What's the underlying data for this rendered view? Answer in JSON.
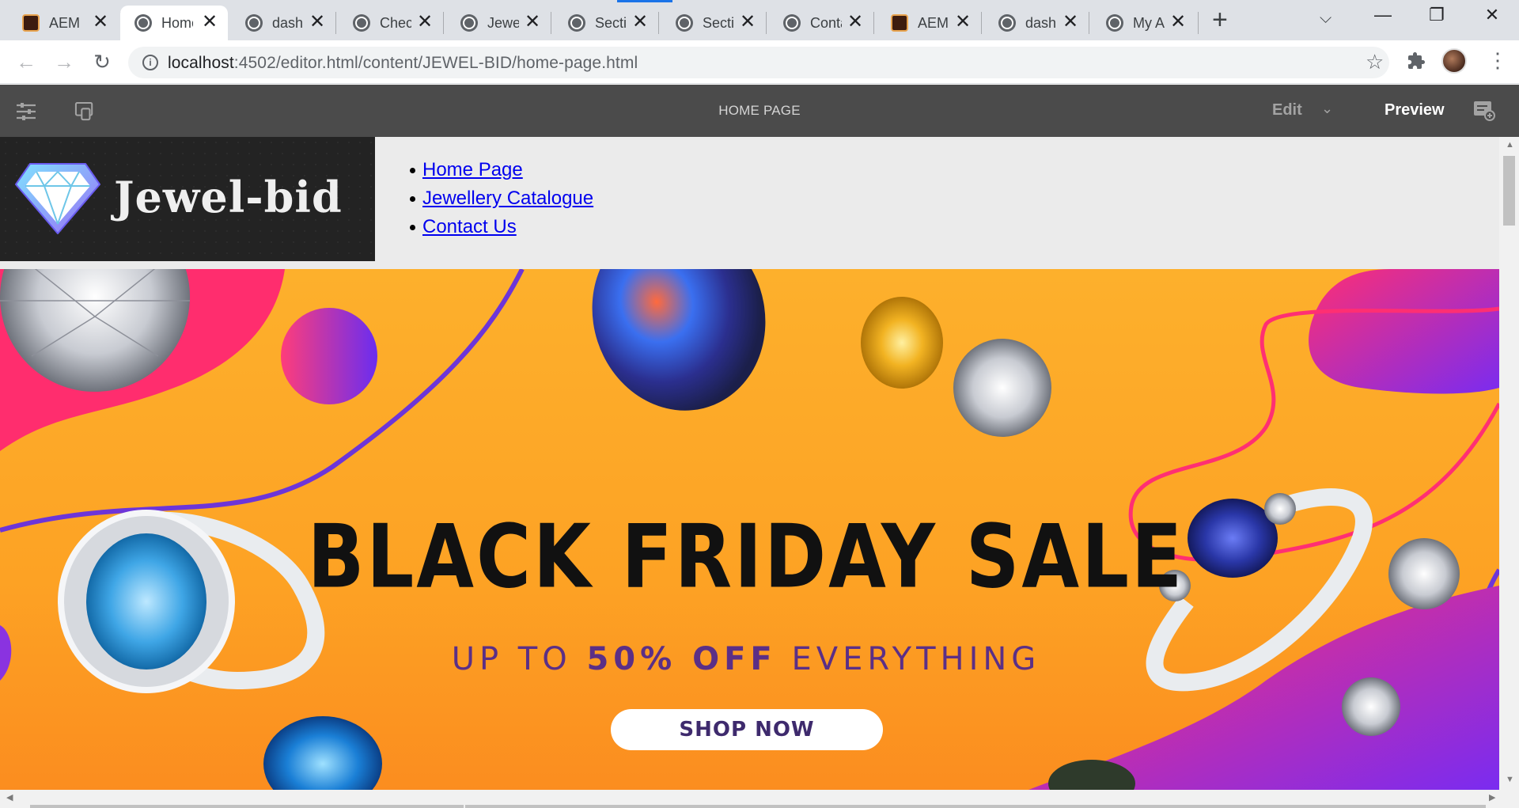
{
  "browser": {
    "tabs": [
      {
        "title": "AEM",
        "icon": "aem-icon"
      },
      {
        "title": "Home",
        "icon": "globe-icon",
        "active": true
      },
      {
        "title": "dashb",
        "icon": "globe-icon"
      },
      {
        "title": "Chec",
        "icon": "globe-icon"
      },
      {
        "title": "Jewel",
        "icon": "globe-icon"
      },
      {
        "title": "Sectio",
        "icon": "globe-icon"
      },
      {
        "title": "Sectio",
        "icon": "globe-icon"
      },
      {
        "title": "Conta",
        "icon": "globe-icon"
      },
      {
        "title": "AEM",
        "icon": "aem-icon"
      },
      {
        "title": "dashb",
        "icon": "globe-icon"
      },
      {
        "title": "My A",
        "icon": "globe-icon"
      }
    ],
    "tab_close_glyph": "✕",
    "new_tab_glyph": "+",
    "url_host": "localhost",
    "url_path": ":4502/editor.html/content/JEWEL-BID/home-page.html",
    "accent_color": "#1a73e8"
  },
  "editor": {
    "page_title": "HOME PAGE",
    "mode_label": "Edit",
    "preview_label": "Preview",
    "bar_color": "#4b4b4b"
  },
  "site": {
    "logo_text": "Jewel-bid",
    "nav": [
      "Home Page",
      "Jewellery Catalogue",
      "Contact Us"
    ],
    "link_color": "#0000ee"
  },
  "banner": {
    "title": "BLACK FRIDAY SALE",
    "subtitle_prefix": "UP TO",
    "subtitle_highlight": "50% OFF",
    "subtitle_suffix": "EVERYTHING",
    "cta_label": "SHOP NOW",
    "background_color": "#fda224"
  }
}
